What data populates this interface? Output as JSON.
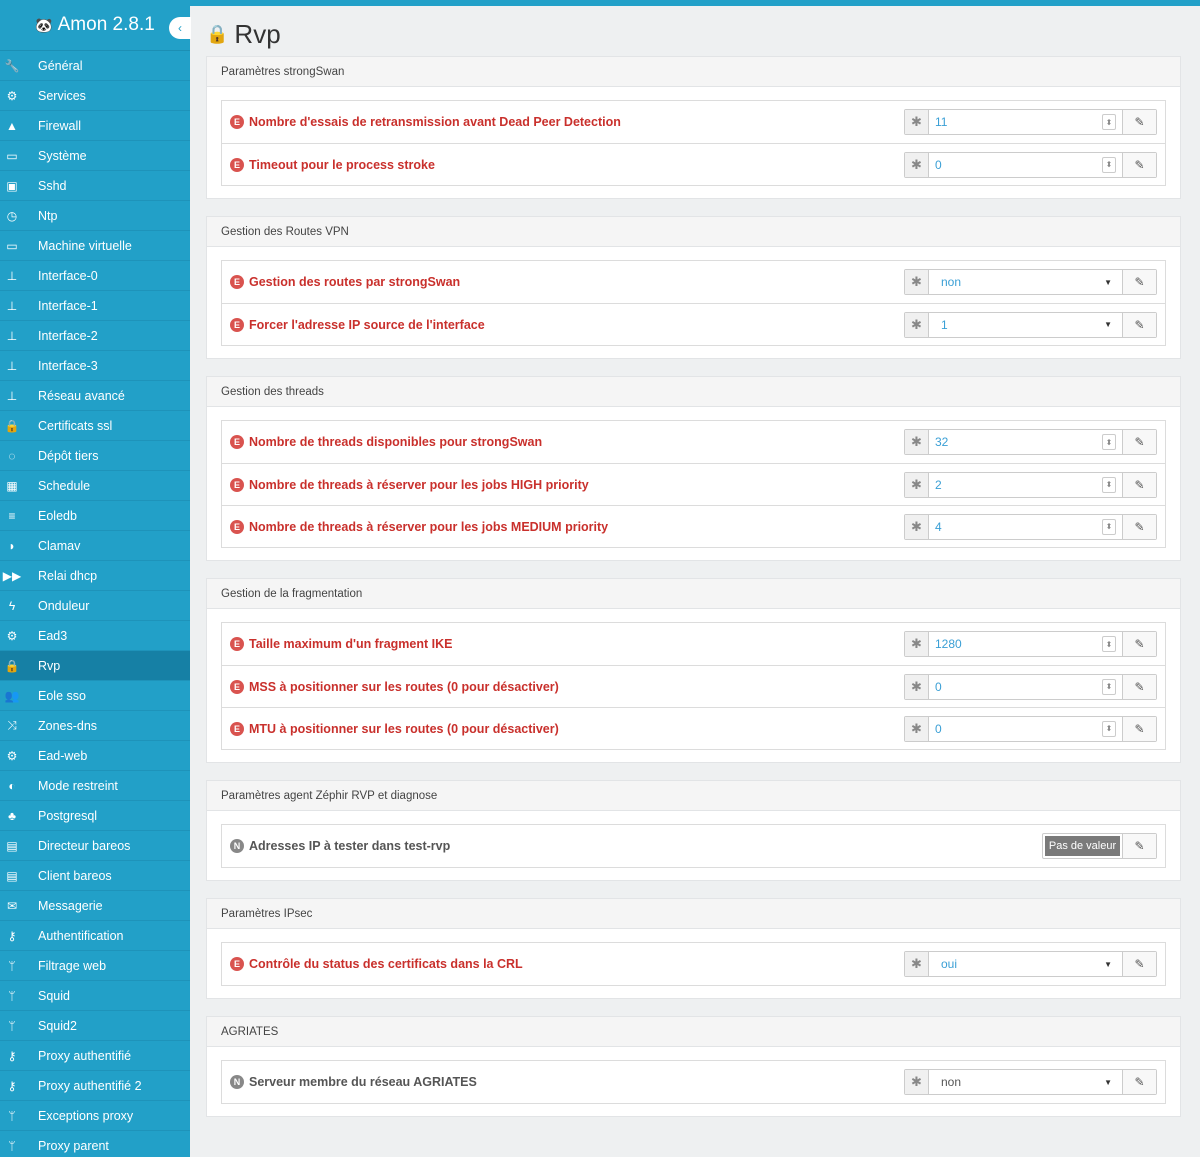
{
  "app": {
    "title": "Amon 2.8.1"
  },
  "sidebar": {
    "items": [
      {
        "label": "Général",
        "icon": "wrench-icon",
        "glyph": "🔧"
      },
      {
        "label": "Services",
        "icon": "gears-icon",
        "glyph": "⚙"
      },
      {
        "label": "Firewall",
        "icon": "fire-extinguisher-icon",
        "glyph": "▲"
      },
      {
        "label": "Système",
        "icon": "desktop-icon",
        "glyph": "▭"
      },
      {
        "label": "Sshd",
        "icon": "terminal-icon",
        "glyph": "▣"
      },
      {
        "label": "Ntp",
        "icon": "clock-icon",
        "glyph": "◷"
      },
      {
        "label": "Machine virtuelle",
        "icon": "desktop-icon",
        "glyph": "▭"
      },
      {
        "label": "Interface-0",
        "icon": "sitemap-icon",
        "glyph": "⊥"
      },
      {
        "label": "Interface-1",
        "icon": "sitemap-icon",
        "glyph": "⊥"
      },
      {
        "label": "Interface-2",
        "icon": "sitemap-icon",
        "glyph": "⊥"
      },
      {
        "label": "Interface-3",
        "icon": "sitemap-icon",
        "glyph": "⊥"
      },
      {
        "label": "Réseau avancé",
        "icon": "sitemap-icon",
        "glyph": "⊥"
      },
      {
        "label": "Certificats ssl",
        "icon": "lock-icon",
        "glyph": "🔒"
      },
      {
        "label": "Dépôt tiers",
        "icon": "circle-notch-icon",
        "glyph": "◌"
      },
      {
        "label": "Schedule",
        "icon": "calendar-icon",
        "glyph": "▦"
      },
      {
        "label": "Eoledb",
        "icon": "database-icon",
        "glyph": "≡"
      },
      {
        "label": "Clamav",
        "icon": "shield-icon",
        "glyph": "◗"
      },
      {
        "label": "Relai dhcp",
        "icon": "fast-forward-icon",
        "glyph": "▶▶"
      },
      {
        "label": "Onduleur",
        "icon": "bolt-icon",
        "glyph": "ϟ"
      },
      {
        "label": "Ead3",
        "icon": "gears-icon",
        "glyph": "⚙"
      },
      {
        "label": "Rvp",
        "icon": "lock-icon",
        "glyph": "🔒"
      },
      {
        "label": "Eole sso",
        "icon": "users-icon",
        "glyph": "👥"
      },
      {
        "label": "Zones-dns",
        "icon": "random-icon",
        "glyph": "⤨"
      },
      {
        "label": "Ead-web",
        "icon": "gear-icon",
        "glyph": "⚙"
      },
      {
        "label": "Mode restreint",
        "icon": "adjust-icon",
        "glyph": "◐"
      },
      {
        "label": "Postgresql",
        "icon": "elephant-icon",
        "glyph": "♣"
      },
      {
        "label": "Directeur bareos",
        "icon": "archive-icon",
        "glyph": "▤"
      },
      {
        "label": "Client bareos",
        "icon": "archive-icon",
        "glyph": "▤"
      },
      {
        "label": "Messagerie",
        "icon": "envelope-icon",
        "glyph": "✉"
      },
      {
        "label": "Authentification",
        "icon": "key-icon",
        "glyph": "⚷"
      },
      {
        "label": "Filtrage web",
        "icon": "code-fork-icon",
        "glyph": "ᛘ"
      },
      {
        "label": "Squid",
        "icon": "code-fork-icon",
        "glyph": "ᛘ"
      },
      {
        "label": "Squid2",
        "icon": "code-fork-icon",
        "glyph": "ᛘ"
      },
      {
        "label": "Proxy authentifié",
        "icon": "key-icon",
        "glyph": "⚷"
      },
      {
        "label": "Proxy authentifié 2",
        "icon": "key-icon",
        "glyph": "⚷"
      },
      {
        "label": "Exceptions proxy",
        "icon": "code-fork-icon",
        "glyph": "ᛘ"
      },
      {
        "label": "Proxy parent",
        "icon": "code-fork-icon",
        "glyph": "ᛘ"
      }
    ],
    "active": "Rvp"
  },
  "page": {
    "title": "Rvp"
  },
  "panels": [
    {
      "heading": "Paramètres strongSwan",
      "rows": [
        {
          "badge": "E",
          "label": "Nombre d'essais de retransmission avant Dead Peer Detection",
          "type": "number",
          "value": "11"
        },
        {
          "badge": "E",
          "label": "Timeout pour le process stroke",
          "type": "number",
          "value": "0"
        }
      ]
    },
    {
      "heading": "Gestion des Routes VPN",
      "rows": [
        {
          "badge": "E",
          "label": "Gestion des routes par strongSwan",
          "type": "select",
          "value": "non"
        },
        {
          "badge": "E",
          "label": "Forcer l'adresse IP source de l'interface",
          "type": "select",
          "value": "1"
        }
      ]
    },
    {
      "heading": "Gestion des threads",
      "rows": [
        {
          "badge": "E",
          "label": "Nombre de threads disponibles pour strongSwan",
          "type": "number",
          "value": "32"
        },
        {
          "badge": "E",
          "label": "Nombre de threads à réserver pour les jobs HIGH priority",
          "type": "number",
          "value": "2"
        },
        {
          "badge": "E",
          "label": "Nombre de threads à réserver pour les jobs MEDIUM priority",
          "type": "number",
          "value": "4"
        }
      ]
    },
    {
      "heading": "Gestion de la fragmentation",
      "rows": [
        {
          "badge": "E",
          "label": "Taille maximum d'un fragment IKE",
          "type": "number",
          "value": "1280"
        },
        {
          "badge": "E",
          "label": "MSS à positionner sur les routes (0 pour désactiver)",
          "type": "number",
          "value": "0"
        },
        {
          "badge": "E",
          "label": "MTU à positionner sur les routes (0 pour désactiver)",
          "type": "number",
          "value": "0"
        }
      ]
    },
    {
      "heading": "Paramètres agent Zéphir RVP et diagnose",
      "rows": [
        {
          "badge": "N",
          "label": "Adresses IP à tester dans test-rvp",
          "type": "novalue",
          "value": "Pas de valeur"
        }
      ]
    },
    {
      "heading": "Paramètres IPsec",
      "rows": [
        {
          "badge": "E",
          "label": "Contrôle du status des certificats dans la CRL",
          "type": "select",
          "value": "oui"
        }
      ]
    },
    {
      "heading": "AGRIATES",
      "rows": [
        {
          "badge": "N",
          "label": "Serveur membre du réseau AGRIATES",
          "type": "select-neutral",
          "value": "non"
        }
      ]
    }
  ],
  "colors": {
    "sidebar": "#22a0c8",
    "sidebar_active": "#1680a5",
    "required": "#c9302c",
    "value": "#3a9fd5"
  }
}
